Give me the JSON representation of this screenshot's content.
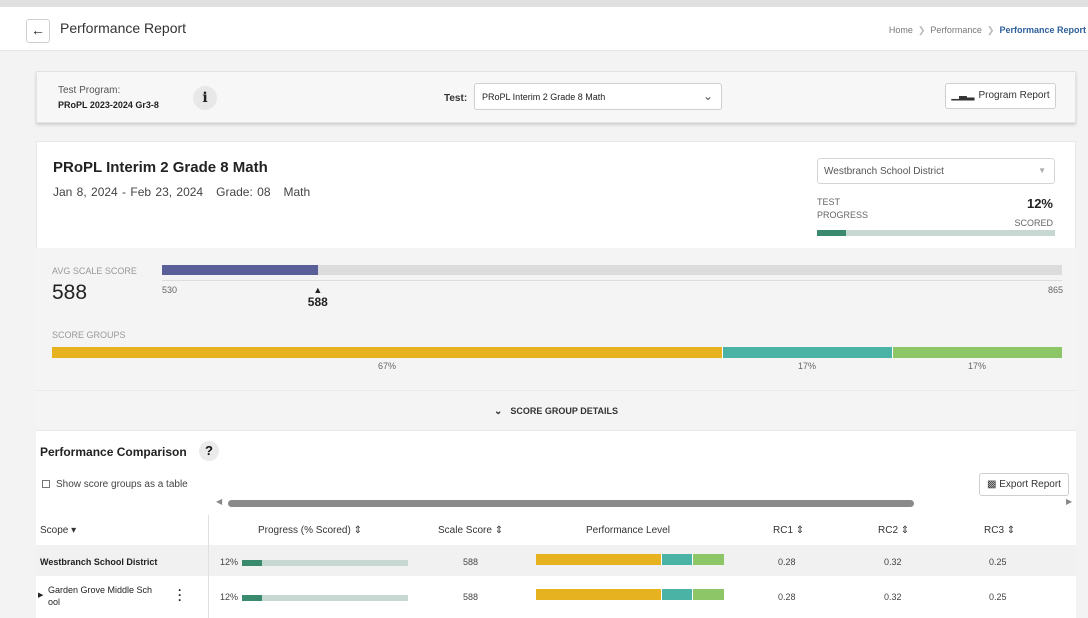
{
  "header": {
    "title": "Performance Report",
    "breadcrumb": [
      "Home",
      "Performance",
      "Performance Report"
    ]
  },
  "program": {
    "label": "Test Program:",
    "value": "PRoPL 2023-2024 Gr3-8",
    "test_label": "Test:",
    "test_value": "PRoPL Interim 2 Grade 8 Math",
    "program_report_label": "Program Report"
  },
  "summary": {
    "title": "PRoPL Interim 2 Grade 8 Math",
    "dates": "Jan 8, 2024 - Feb 23, 2024",
    "grade": "Grade: 08",
    "subject": "Math",
    "district_select": "Westbranch School District",
    "test_progress_label_1": "TEST",
    "test_progress_label_2": "PROGRESS",
    "test_progress_pct": "12%",
    "test_progress_scored": "SCORED",
    "test_progress_value": 0.12
  },
  "scores": {
    "avg_label": "AVG SCALE SCORE",
    "avg_value": "588",
    "scale_min": "530",
    "scale_max": "865",
    "score": 588,
    "min": 530,
    "max": 865,
    "marker_label": "588",
    "groups_label": "SCORE GROUPS",
    "groups": [
      {
        "pct": 67,
        "label": "67%",
        "color": "#e6b21f"
      },
      {
        "pct": 17,
        "label": "17%",
        "color": "#4ab3a6"
      },
      {
        "pct": 17,
        "label": "17%",
        "color": "#8cc667"
      }
    ],
    "details_label": "SCORE GROUP DETAILS"
  },
  "comparison": {
    "title": "Performance Comparison",
    "help": "?",
    "show_table_label": "Show score groups as a table",
    "export_label": "Export Report",
    "columns": {
      "scope": "Scope",
      "progress": "Progress (% Scored)",
      "scale": "Scale Score",
      "perf": "Performance Level",
      "rc1": "RC1",
      "rc2": "RC2",
      "rc3": "RC3"
    },
    "rows": [
      {
        "scope": "Westbranch School District",
        "progress_label": "12%",
        "progress": 0.12,
        "scale": "588",
        "perf": [
          67,
          17,
          17
        ],
        "rc1": "0.28",
        "rc2": "0.32",
        "rc3": "0.25"
      },
      {
        "scope_line1": "Garden Grove Middle Sch",
        "scope_line2": "ool",
        "progress_label": "12%",
        "progress": 0.12,
        "scale": "588",
        "perf": [
          67,
          17,
          17
        ],
        "rc1": "0.28",
        "rc2": "0.32",
        "rc3": "0.25"
      }
    ]
  },
  "colors": {
    "avg_bar": "#5b5f99",
    "progress_fill": "#3a8a6d",
    "progress_track": "#c7d8d2"
  }
}
